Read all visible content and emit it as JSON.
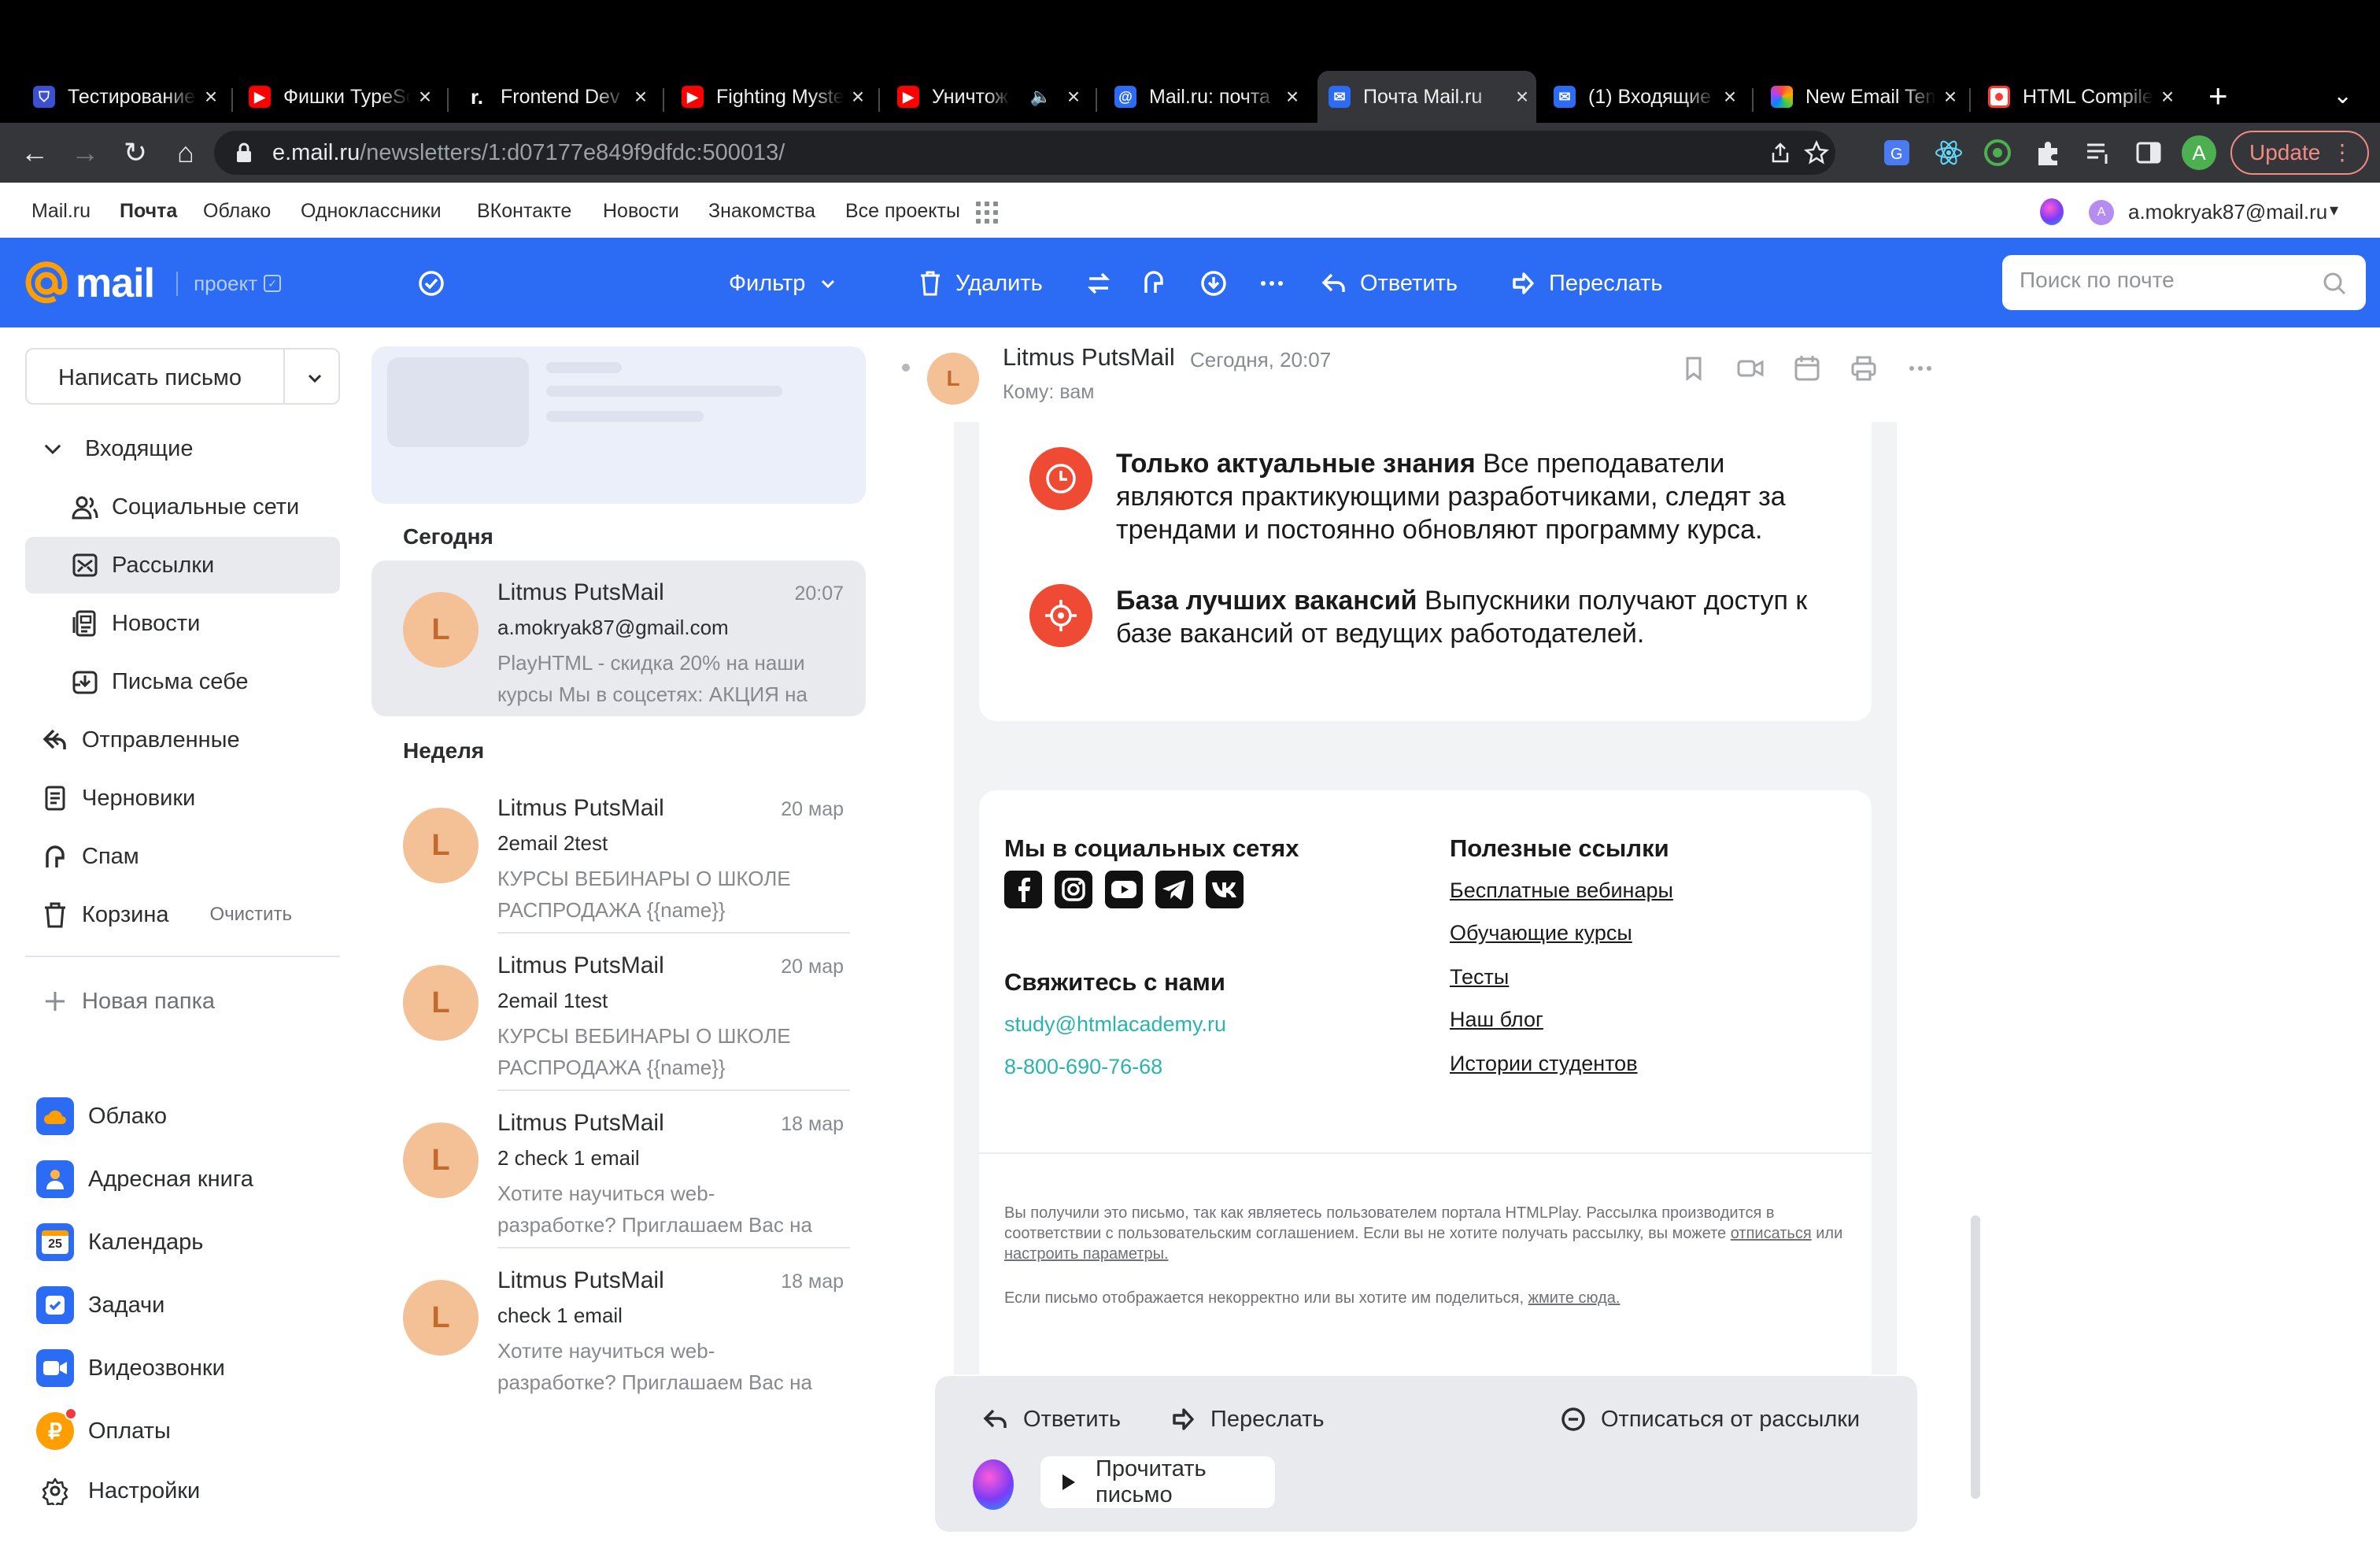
{
  "browser": {
    "tabs": [
      {
        "title": "Тестирование",
        "favicon": "shield-icon",
        "color": "#ffffff"
      },
      {
        "title": "Фишки TypeScript",
        "favicon": "youtube-icon",
        "color": "#ff0000"
      },
      {
        "title": "Frontend Dev",
        "favicon": "r-icon",
        "color": "#000000"
      },
      {
        "title": "Fighting Mystery",
        "favicon": "youtube-icon",
        "color": "#ff0000"
      },
      {
        "title": "Уничтожение",
        "favicon": "youtube-icon",
        "color": "#ff0000"
      },
      {
        "title": "Mail.ru: почта",
        "favicon": "at-icon",
        "color": "#2c6bf4"
      },
      {
        "title": "Почта Mail.ru",
        "favicon": "mail-icon",
        "color": "#2c6bf4"
      },
      {
        "title": "(1) Входящие",
        "favicon": "mail-icon",
        "color": "#2c6bf4"
      },
      {
        "title": "New Email Template",
        "favicon": "palette-icon",
        "color": "#f0a030"
      },
      {
        "title": "HTML Compiler",
        "favicon": "target-icon",
        "color": "#ff3b30"
      }
    ],
    "url_host": "e.mail.ru",
    "url_path": "/newsletters/1:d07177e849f9dfdc:500013/",
    "update_label": "Update",
    "profile_initial": "A"
  },
  "portal": {
    "links": [
      "Mail.ru",
      "Почта",
      "Облако",
      "Одноклассники",
      "ВКонтакте",
      "Новости",
      "Знакомства",
      "Все проекты"
    ],
    "user_email": "a.mokryak87@mail.ru"
  },
  "header": {
    "logo_word": "mail",
    "logo_suffix": "проект",
    "filter_label": "Фильтр",
    "delete_label": "Удалить",
    "reply_label": "Ответить",
    "forward_label": "Переслать",
    "search_placeholder": "Поиск по почте",
    "brand_color": "#2c6bf4"
  },
  "sidebar": {
    "compose_label": "Написать письмо",
    "folders": [
      {
        "label": "Входящие",
        "icon": "chevron-down-icon"
      },
      {
        "label": "Социальные сети",
        "icon": "people-icon"
      },
      {
        "label": "Рассылки",
        "icon": "newsletter-icon"
      },
      {
        "label": "Новости",
        "icon": "news-icon"
      },
      {
        "label": "Письма себе",
        "icon": "inbox-self-icon"
      },
      {
        "label": "Отправленные",
        "icon": "sent-icon"
      },
      {
        "label": "Черновики",
        "icon": "draft-icon"
      },
      {
        "label": "Спам",
        "icon": "spam-icon"
      },
      {
        "label": "Корзина",
        "icon": "trash-icon",
        "extra": "Очистить"
      }
    ],
    "new_folder_label": "Новая папка",
    "services": [
      {
        "label": "Облако",
        "icon": "cloud-icon"
      },
      {
        "label": "Адресная книга",
        "icon": "contacts-icon"
      },
      {
        "label": "Календарь",
        "icon": "calendar-icon",
        "badge": "25"
      },
      {
        "label": "Задачи",
        "icon": "tasks-icon"
      },
      {
        "label": "Видеозвонки",
        "icon": "video-icon"
      },
      {
        "label": "Оплаты",
        "icon": "payments-icon"
      },
      {
        "label": "Настройки",
        "icon": "settings-icon"
      }
    ]
  },
  "list": {
    "groups": [
      "Сегодня",
      "Неделя"
    ],
    "messages": [
      {
        "from": "Litmus PutsMail",
        "time": "20:07",
        "subject": "a.mokryak87@gmail.com",
        "snippet": "PlayHTML - скидка 20% на наши курсы Мы в соцсетях: АКЦИЯ на",
        "initial": "L"
      },
      {
        "from": "Litmus PutsMail",
        "time": "20 мар",
        "subject": "2email 2test",
        "snippet": "КУРСЫ ВЕБИНАРЫ О ШКОЛЕ РАСПРОДАЖА {{name}}",
        "initial": "L"
      },
      {
        "from": "Litmus PutsMail",
        "time": "20 мар",
        "subject": "2email 1test",
        "snippet": "КУРСЫ ВЕБИНАРЫ О ШКОЛЕ РАСПРОДАЖА {{name}}",
        "initial": "L"
      },
      {
        "from": "Litmus PutsMail",
        "time": "18 мар",
        "subject": "2 check 1 email",
        "snippet": "Хотите научиться web-разработке? Приглашаем Вас на бесплатный",
        "initial": "L"
      },
      {
        "from": "Litmus PutsMail",
        "time": "18 мар",
        "subject": "check 1 email",
        "snippet": "Хотите научиться web-разработке? Приглашаем Вас на бесплатный",
        "initial": "L"
      }
    ]
  },
  "reader": {
    "from": "Litmus PutsMail",
    "date": "Сегодня, 20:07",
    "to": "Кому: вам",
    "initial": "L",
    "features": [
      {
        "title": "Только актуальные знания",
        "text": " Все преподаватели являются практикующими разработчиками, следят за трендами и постоянно обновляют программу курса."
      },
      {
        "title": "База лучших вакансий",
        "text": " Выпускники получают доступ к базе вакансий от ведущих работодателей."
      }
    ],
    "social_title": "Мы в социальных сетях",
    "social_icons": [
      "facebook-icon",
      "instagram-icon",
      "youtube-icon",
      "telegram-icon",
      "vk-icon"
    ],
    "contact_title": "Свяжитесь с нами",
    "contact_email": "study@htmlacademy.ru",
    "contact_phone": "8-800-690-76-68",
    "useful_title": "Полезные ссылки",
    "useful_links": [
      "Бесплатные вебинары",
      "Обучающие курсы",
      "Тесты",
      "Наш блог",
      "Истории студентов"
    ],
    "fine1_a": "Вы получили это письмо, так как являетесь пользователем портала HTMLPlay. Рассылка производится в соответствии с пользовательским соглашением. Если вы не хотите получать рассылку, вы можете ",
    "fine1_link1": "отписаться",
    "fine1_mid": " или ",
    "fine1_link2": "настроить параметры.",
    "fine2_a": "Если письмо отображается некорректно или вы хотите им поделиться, ",
    "fine2_link": "жмите сюда.",
    "accent_color": "#ef4b34",
    "link_color": "#2bb3ad"
  },
  "actions": {
    "reply": "Ответить",
    "forward": "Переслать",
    "unsubscribe": "Отписаться от рассылки",
    "read_aloud": "Прочитать письмо"
  }
}
